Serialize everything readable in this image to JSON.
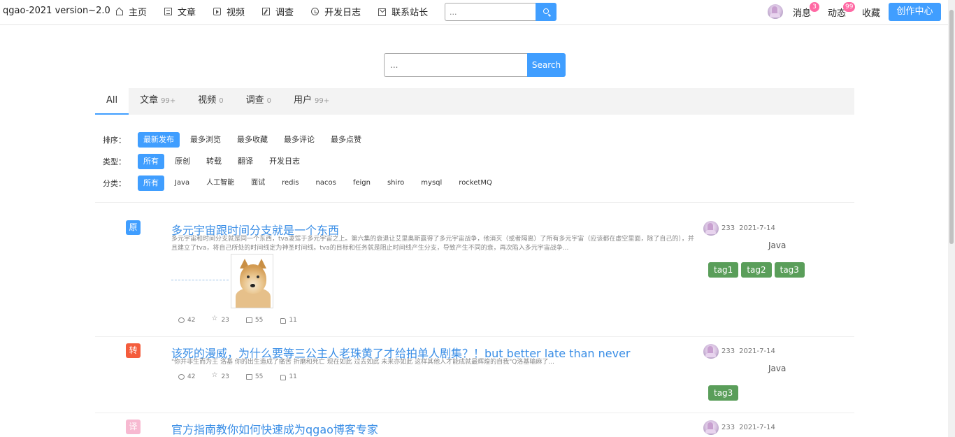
{
  "navbar": {
    "brand": "qgao-2021 version~2.0",
    "items": [
      {
        "label": "主页",
        "icon": "home-icon"
      },
      {
        "label": "文章",
        "icon": "document-icon"
      },
      {
        "label": "视频",
        "icon": "video-icon"
      },
      {
        "label": "调查",
        "icon": "edit-icon"
      },
      {
        "label": "开发日志",
        "icon": "history-icon"
      },
      {
        "label": "联系站长",
        "icon": "mail-icon"
      }
    ],
    "search_placeholder": "...",
    "messages_label": "消息",
    "messages_count": "3",
    "activity_label": "动态",
    "activity_count": "99",
    "favorites_label": "收藏",
    "create_label": "创作中心"
  },
  "search": {
    "placeholder": "...",
    "button_label": "Search"
  },
  "tabs": [
    {
      "label": "All",
      "count": ""
    },
    {
      "label": "文章",
      "count": "99+"
    },
    {
      "label": "视频",
      "count": "0"
    },
    {
      "label": "调查",
      "count": "0"
    },
    {
      "label": "用户",
      "count": "99+"
    }
  ],
  "filters": {
    "sort": {
      "label": "排序：",
      "options": [
        "最新发布",
        "最多浏览",
        "最多收藏",
        "最多评论",
        "最多点赞"
      ]
    },
    "type": {
      "label": "类型：",
      "options": [
        "所有",
        "原创",
        "转载",
        "翻译",
        "开发日志"
      ]
    },
    "category": {
      "label": "分类：",
      "options": [
        "所有",
        "Java",
        "人工智能",
        "面试",
        "redis",
        "nacos",
        "feign",
        "shiro",
        "mysql",
        "rocketMQ"
      ]
    }
  },
  "articles": [
    {
      "type_label": "原",
      "title": "多元宇宙跟时间分支就是一个东西",
      "desc": "多元宇宙和时间分支就是同一个东西，tva凌驾于多元宇宙之上。第六集的衰退让艾里奥斯赢得了多元宇宙战争，他消灭（或者隔离）了所有多元宇宙（应该都在虚空里面，除了自己的），并且建立了tva，将自己所处的时间线定为神圣时间线。tva的目标和任务就是阻止时间线产生分支，导致产生不同的衰，再次陷入多元宇宙战争...",
      "views": "42",
      "stars": "23",
      "comments": "55",
      "likes": "11",
      "author_id": "233",
      "date": "2021-7-14",
      "category": "Java",
      "tags": [
        "tag1",
        "tag2",
        "tag3"
      ]
    },
    {
      "type_label": "转",
      "title": "该死的漫威，为什么要等三公主人老珠黄了才给拍单人剧集？！but better late than never",
      "desc": "\"你并非生而为王 洛基 你的出生造成了痛苦 折磨和死亡 现在如此 过去如此 未来亦如此 这样其他人才能成就最辉煌的自我\"Q洛基输麻了...",
      "views": "42",
      "stars": "23",
      "comments": "55",
      "likes": "11",
      "author_id": "233",
      "date": "2021-7-14",
      "category": "Java",
      "tags": [
        "tag3"
      ]
    },
    {
      "type_label": "译",
      "title": "官方指南教你如何快速成为qgao博客专家",
      "desc": "",
      "author_id": "233",
      "date": "2021-7-14"
    }
  ],
  "colors": {
    "accent": "#409eff",
    "tag_green": "#5a9e5a",
    "badge_pink": "#ff69a4",
    "original_badge": "#409eff",
    "repost_badge": "#f45c3c",
    "translate_badge": "#f7b9d1"
  }
}
